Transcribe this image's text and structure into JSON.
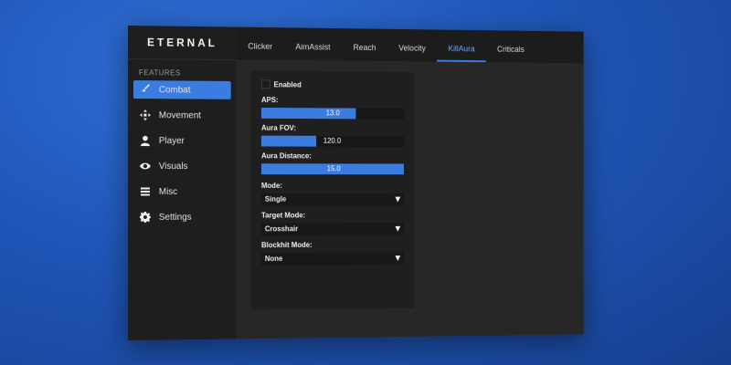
{
  "app": {
    "logo": "ETERNAL"
  },
  "sidebar": {
    "section_label": "FEATURES",
    "items": [
      {
        "label": "Combat",
        "icon": "sword-icon",
        "active": true
      },
      {
        "label": "Movement",
        "icon": "move-arrows-icon",
        "active": false
      },
      {
        "label": "Player",
        "icon": "user-icon",
        "active": false
      },
      {
        "label": "Visuals",
        "icon": "eye-icon",
        "active": false
      },
      {
        "label": "Misc",
        "icon": "menu-lines-icon",
        "active": false
      },
      {
        "label": "Settings",
        "icon": "gear-icon",
        "active": false
      }
    ]
  },
  "tabs": [
    {
      "label": "Clicker",
      "active": false
    },
    {
      "label": "AimAssist",
      "active": false
    },
    {
      "label": "Reach",
      "active": false
    },
    {
      "label": "Velocity",
      "active": false
    },
    {
      "label": "KillAura",
      "active": true
    },
    {
      "label": "Criticals",
      "active": false
    }
  ],
  "killaura": {
    "enabled_label": "Enabled",
    "aps": {
      "label": "APS:",
      "value": "13.0",
      "fill_fraction": 0.66
    },
    "fov": {
      "label": "Aura FOV:",
      "value": "120.0",
      "fill_fraction": 0.38
    },
    "distance": {
      "label": "Aura Distance:",
      "value": "15.0",
      "fill_fraction": 1.0
    },
    "mode": {
      "label": "Mode:",
      "value": "Single"
    },
    "target_mode": {
      "label": "Target Mode:",
      "value": "Crosshair"
    },
    "blockhit_mode": {
      "label": "Blockhit Mode:",
      "value": "None"
    }
  },
  "colors": {
    "accent": "#3b7ce0",
    "background": "#1f56b8"
  }
}
